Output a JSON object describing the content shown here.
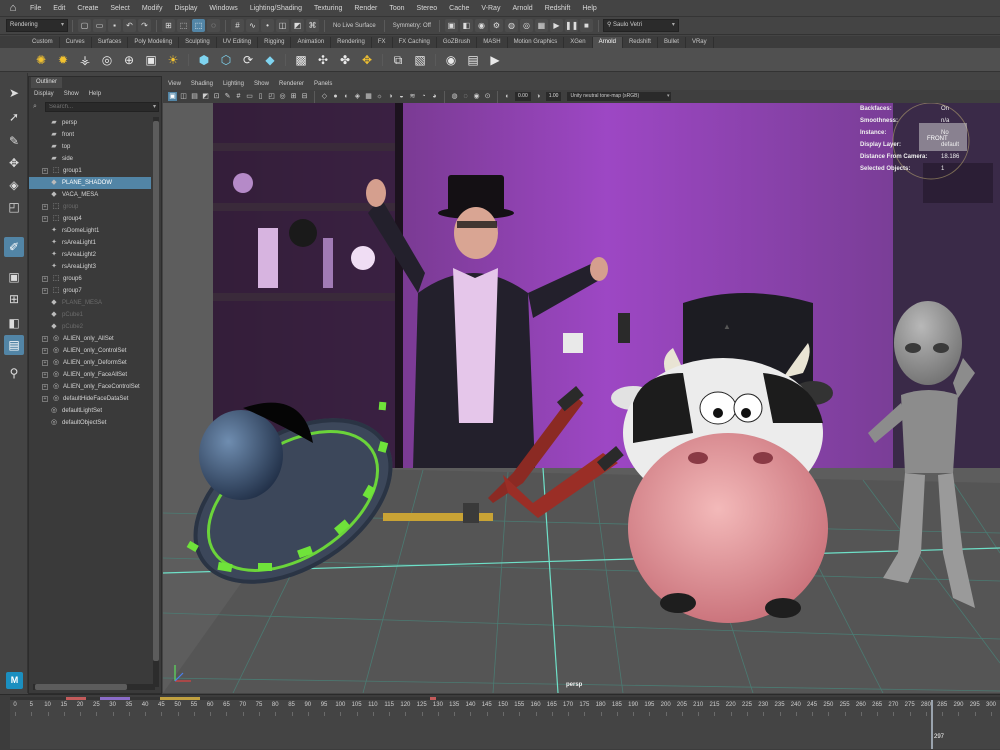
{
  "menubar": [
    "File",
    "Edit",
    "Create",
    "Select",
    "Modify",
    "Display",
    "Windows",
    "Lighting/Shading",
    "Texturing",
    "Render",
    "Toon",
    "Stereo",
    "Cache",
    "V-Ray",
    "Arnold",
    "Redshift",
    "Help"
  ],
  "status": {
    "mode": "Rendering",
    "live_surface": "No Live Surface",
    "symmetry": "Symmetry: Off",
    "user": "Saulo Vetri"
  },
  "shelf_tabs": [
    "Custom",
    "Curves",
    "Surfaces",
    "Poly Modeling",
    "Sculpting",
    "UV Editing",
    "Rigging",
    "Animation",
    "Rendering",
    "FX",
    "FX Caching",
    "GoZBrush",
    "MASH",
    "Motion Graphics",
    "XGen",
    "Arnold",
    "Redshift",
    "Bullet",
    "VRay"
  ],
  "shelf_active": "Arnold",
  "outliner": {
    "tab": "Outliner",
    "menu": [
      "Display",
      "Show",
      "Help"
    ],
    "search_placeholder": "Search...",
    "items": [
      {
        "label": "persp",
        "indent": 0,
        "icon": "camera-icon",
        "expand": false,
        "selected": false,
        "dim": false
      },
      {
        "label": "front",
        "indent": 0,
        "icon": "camera-icon",
        "expand": false,
        "selected": false,
        "dim": false
      },
      {
        "label": "top",
        "indent": 0,
        "icon": "camera-icon",
        "expand": false,
        "selected": false,
        "dim": false
      },
      {
        "label": "side",
        "indent": 0,
        "icon": "camera-icon",
        "expand": false,
        "selected": false,
        "dim": false
      },
      {
        "label": "group1",
        "indent": 0,
        "icon": "group-icon",
        "expand": true,
        "selected": false,
        "dim": false
      },
      {
        "label": "PLANE_SHADOW",
        "indent": 0,
        "icon": "mesh-icon",
        "expand": false,
        "selected": true,
        "dim": false
      },
      {
        "label": "VACA_MESA",
        "indent": 0,
        "icon": "mesh-icon",
        "expand": false,
        "selected": false,
        "dim": false
      },
      {
        "label": "group",
        "indent": 0,
        "icon": "group-icon",
        "expand": true,
        "selected": false,
        "dim": true
      },
      {
        "label": "group4",
        "indent": 0,
        "icon": "group-icon",
        "expand": true,
        "selected": false,
        "dim": false
      },
      {
        "label": "rsDomeLight1",
        "indent": 0,
        "icon": "light-icon",
        "expand": false,
        "selected": false,
        "dim": false
      },
      {
        "label": "rsAreaLight1",
        "indent": 0,
        "icon": "light-icon",
        "expand": false,
        "selected": false,
        "dim": false
      },
      {
        "label": "rsAreaLight2",
        "indent": 0,
        "icon": "light-icon",
        "expand": false,
        "selected": false,
        "dim": false
      },
      {
        "label": "rsAreaLight3",
        "indent": 0,
        "icon": "light-icon",
        "expand": false,
        "selected": false,
        "dim": false
      },
      {
        "label": "group6",
        "indent": 0,
        "icon": "group-icon",
        "expand": true,
        "selected": false,
        "dim": false
      },
      {
        "label": "group7",
        "indent": 0,
        "icon": "group-icon",
        "expand": true,
        "selected": false,
        "dim": false
      },
      {
        "label": "PLANE_MESA",
        "indent": 0,
        "icon": "mesh-icon",
        "expand": false,
        "selected": false,
        "dim": true
      },
      {
        "label": "pCube1",
        "indent": 0,
        "icon": "mesh-icon",
        "expand": false,
        "selected": false,
        "dim": true
      },
      {
        "label": "pCube2",
        "indent": 0,
        "icon": "mesh-icon",
        "expand": false,
        "selected": false,
        "dim": true
      },
      {
        "label": "ALIEN_only_AllSet",
        "indent": 0,
        "icon": "set-icon",
        "expand": true,
        "selected": false,
        "dim": false
      },
      {
        "label": "ALIEN_only_ControlSet",
        "indent": 0,
        "icon": "set-icon",
        "expand": true,
        "selected": false,
        "dim": false
      },
      {
        "label": "ALIEN_only_DeformSet",
        "indent": 0,
        "icon": "set-icon",
        "expand": true,
        "selected": false,
        "dim": false
      },
      {
        "label": "ALIEN_only_FaceAllSet",
        "indent": 0,
        "icon": "set-icon",
        "expand": true,
        "selected": false,
        "dim": false
      },
      {
        "label": "ALIEN_only_FaceControlSet",
        "indent": 0,
        "icon": "set-icon",
        "expand": true,
        "selected": false,
        "dim": false
      },
      {
        "label": "defaultHideFaceDataSet",
        "indent": 0,
        "icon": "set-icon",
        "expand": true,
        "selected": false,
        "dim": false
      },
      {
        "label": "defaultLightSet",
        "indent": 0,
        "icon": "set-icon",
        "expand": false,
        "selected": false,
        "dim": false
      },
      {
        "label": "defaultObjectSet",
        "indent": 0,
        "icon": "set-icon",
        "expand": false,
        "selected": false,
        "dim": false
      }
    ]
  },
  "viewport": {
    "menu": [
      "View",
      "Shading",
      "Lighting",
      "Show",
      "Renderer",
      "Panels"
    ],
    "exposure": "0.00",
    "gamma": "1.00",
    "color_transform": "Unity neutral tone-map (sRGB)",
    "camera": "persp",
    "hud": [
      {
        "label": "Backfaces:",
        "value": "On"
      },
      {
        "label": "Smoothness:",
        "value": "n/a"
      },
      {
        "label": "Instance:",
        "value": "No"
      },
      {
        "label": "Display Layer:",
        "value": "default"
      },
      {
        "label": "Distance From Camera:",
        "value": "18.186"
      },
      {
        "label": "Selected Objects:",
        "value": "1"
      }
    ],
    "viewcube_label": "FRONT"
  },
  "timeline": {
    "ticks": [
      "0",
      "5",
      "10",
      "15",
      "20",
      "25",
      "30",
      "35",
      "40",
      "45",
      "50",
      "55",
      "60",
      "65",
      "70",
      "75",
      "80",
      "85",
      "90",
      "95",
      "100",
      "105",
      "110",
      "115",
      "120",
      "125",
      "130",
      "135",
      "140",
      "145",
      "150",
      "155",
      "160",
      "165",
      "170",
      "175",
      "180",
      "185",
      "190",
      "195",
      "200",
      "205",
      "210",
      "215",
      "220",
      "225",
      "230",
      "235",
      "240",
      "245",
      "250",
      "255",
      "260",
      "265",
      "270",
      "275",
      "280",
      "285",
      "290",
      "295",
      "300"
    ],
    "current_frame": "297"
  },
  "colors": {
    "accent": "#5285a6",
    "wall": "#8a3fb0",
    "grid": "#6ee0c8"
  }
}
